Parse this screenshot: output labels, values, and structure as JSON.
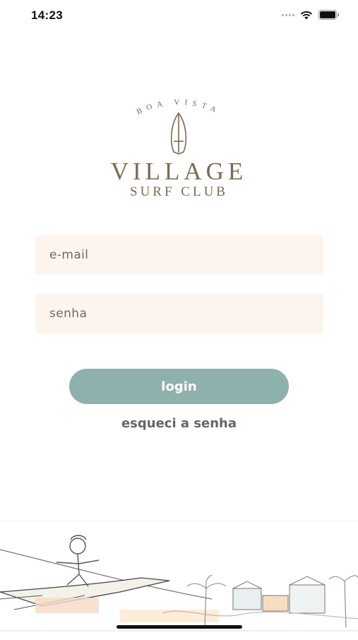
{
  "status_bar": {
    "time": "14:23",
    "signal_icon": "signal-icon",
    "wifi_icon": "wifi-icon",
    "battery_icon": "battery-icon"
  },
  "logo": {
    "arc_text": "BOA VISTA",
    "title": "VILLAGE",
    "subtitle": "SURF CLUB",
    "icon": "surfboard-icon",
    "color": "#7a6a4f"
  },
  "form": {
    "email": {
      "placeholder": "e-mail",
      "value": ""
    },
    "password": {
      "placeholder": "senha",
      "value": ""
    },
    "field_background": "#fdf4ee"
  },
  "actions": {
    "login_label": "login",
    "login_color": "#8fb1ae",
    "forgot_label": "esqueci a senha"
  },
  "illustration": {
    "icon": "surfer-illustration"
  }
}
